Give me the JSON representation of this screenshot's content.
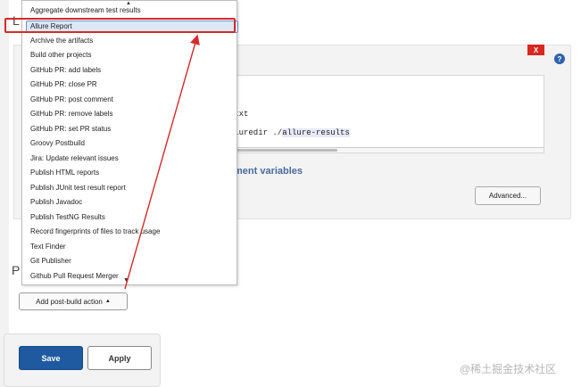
{
  "dropdown": {
    "items": [
      "Aggregate downstream test results",
      "Allure Report",
      "Archive the artifacts",
      "Build other projects",
      "GitHub PR: add labels",
      "GitHub PR: close PR",
      "GitHub PR: post comment",
      "GitHub PR: remove labels",
      "GitHub PR: set PR status",
      "Groovy Postbuild",
      "Jira: Update relevant issues",
      "Publish HTML reports",
      "Publish JUnit test result report",
      "Publish Javadoc",
      "Publish TestNG Results",
      "Record fingerprints of files to track usage",
      "Text Finder",
      "Git Publisher",
      "Github Pull Request Merger"
    ],
    "scroll_up_glyph": "▲",
    "scroll_down_glyph": "▼"
  },
  "config": {
    "close_label": "X",
    "help_label": "?",
    "code_line_1": "ts.txt",
    "code_line_2_a": "-alluredir ./",
    "code_line_2_b": "allure-results",
    "env_link": "ment variables",
    "advanced_label": "Advanced..."
  },
  "post_build": {
    "add_label": "Add post-build action",
    "add_caret": "▲"
  },
  "footer": {
    "save_label": "Save",
    "apply_label": "Apply"
  },
  "clipped": {
    "letter_top": "L",
    "letter_bottom": "P"
  },
  "watermark": "@稀土掘金技术社区",
  "colors": {
    "annotation": "#d52b2b",
    "primary": "#1f5aa0",
    "danger": "#d8281f"
  }
}
